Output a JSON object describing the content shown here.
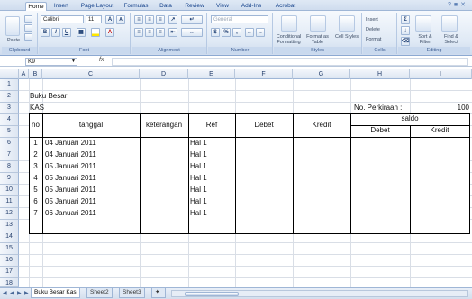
{
  "ribbon": {
    "tabs": [
      "Home",
      "Insert",
      "Page Layout",
      "Formulas",
      "Data",
      "Review",
      "View",
      "Add-Ins",
      "Acrobat"
    ],
    "active_tab": "Home",
    "groups": {
      "clipboard": {
        "label": "Clipboard",
        "paste": "Paste"
      },
      "font": {
        "label": "Font",
        "family": "Calibri",
        "size": "11",
        "bold": "B",
        "italic": "I",
        "underline": "U",
        "grow": "A",
        "shrink": "A"
      },
      "alignment": {
        "label": "Alignment"
      },
      "number": {
        "label": "Number",
        "format": "General",
        "currency": "$",
        "percent": "%",
        "comma": ","
      },
      "styles": {
        "label": "Styles",
        "conditional": "Conditional Formatting",
        "format_table": "Format as Table",
        "cell_styles": "Cell Styles"
      },
      "cells": {
        "label": "Cells",
        "insert": "Insert",
        "delete": "Delete",
        "format": "Format"
      },
      "editing": {
        "label": "Editing",
        "sort": "Sort & Filter",
        "find": "Find & Select"
      }
    }
  },
  "formula_bar": {
    "name_box": "K9",
    "fx": "fx",
    "value": ""
  },
  "columns": [
    "A",
    "B",
    "C",
    "D",
    "E",
    "F",
    "G",
    "H",
    "I"
  ],
  "rows": [
    "1",
    "2",
    "3",
    "4",
    "5",
    "6",
    "7",
    "8",
    "9",
    "10",
    "11",
    "12",
    "13",
    "14",
    "15",
    "16",
    "17",
    "18"
  ],
  "sheet": {
    "title": "Buku Besar",
    "account": "KAS",
    "account_no_label": "No. Perkiraan :",
    "account_no": "100",
    "headers": {
      "no": "no",
      "tanggal": "tanggal",
      "keterangan": "keterangan",
      "ref": "Ref",
      "debet": "Debet",
      "kredit": "Kredit",
      "saldo": "saldo",
      "saldo_debet": "Debet",
      "saldo_kredit": "Kredit"
    },
    "entries": [
      {
        "no": "1",
        "tanggal": "04 Januari 2011",
        "ref": "Hal 1"
      },
      {
        "no": "2",
        "tanggal": "04 Januari 2011",
        "ref": "Hal 1"
      },
      {
        "no": "3",
        "tanggal": "05 Januari 2011",
        "ref": "Hal 1"
      },
      {
        "no": "4",
        "tanggal": "05 Januari 2011",
        "ref": "Hal 1"
      },
      {
        "no": "5",
        "tanggal": "05 Januari 2011",
        "ref": "Hal 1"
      },
      {
        "no": "6",
        "tanggal": "05 Januari 2011",
        "ref": "Hal 1"
      },
      {
        "no": "7",
        "tanggal": "06 Januari 2011",
        "ref": "Hal 1"
      }
    ]
  },
  "sheet_tabs": [
    "Buku Besar Kas",
    "Sheet2",
    "Sheet3"
  ],
  "active_sheet": "Buku Besar Kas"
}
